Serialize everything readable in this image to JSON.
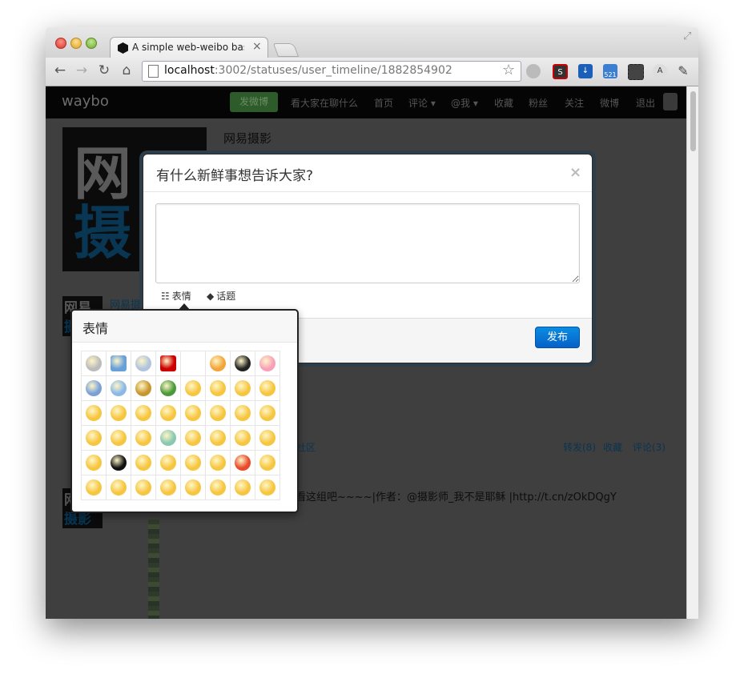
{
  "browser": {
    "tab_title": "A simple web-weibo base on",
    "tab_close": "×",
    "url_host": "localhost",
    "url_path": ":3002/statuses/user_timeline/1882854902",
    "ext_badge": "521"
  },
  "site": {
    "brand": "waybo",
    "post_button": "发微博",
    "nav": [
      "看大家在聊什么",
      "首页",
      "评论 ▾",
      "@我 ▾",
      "收藏",
      "粉丝",
      "关注",
      "微博",
      "退出"
    ]
  },
  "profile": {
    "name": "网易摄影",
    "avatar_chars": [
      "网",
      "摄"
    ],
    "small_avatar_chars": [
      "网易",
      "摄影"
    ],
    "link_name": "网易摄",
    "community": "社区",
    "actions": [
      "转发(8)",
      "收藏",
      "评论(3)"
    ],
    "post_text": "看这组吧~~~~|作者：@摄影师_我不是耶稣 |http://t.cn/zOkDQgY"
  },
  "modal": {
    "title": "有什么新鲜事想告诉大家?",
    "close": "×",
    "emoticon_link": "表情",
    "topic_link": "话题",
    "publish": "发布"
  },
  "emoticon_popover": {
    "title": "表情"
  },
  "colors": {
    "publish_button": "#0a70d6",
    "nav_bg": "#050505",
    "overlay_bg": "#3f3f3f"
  }
}
